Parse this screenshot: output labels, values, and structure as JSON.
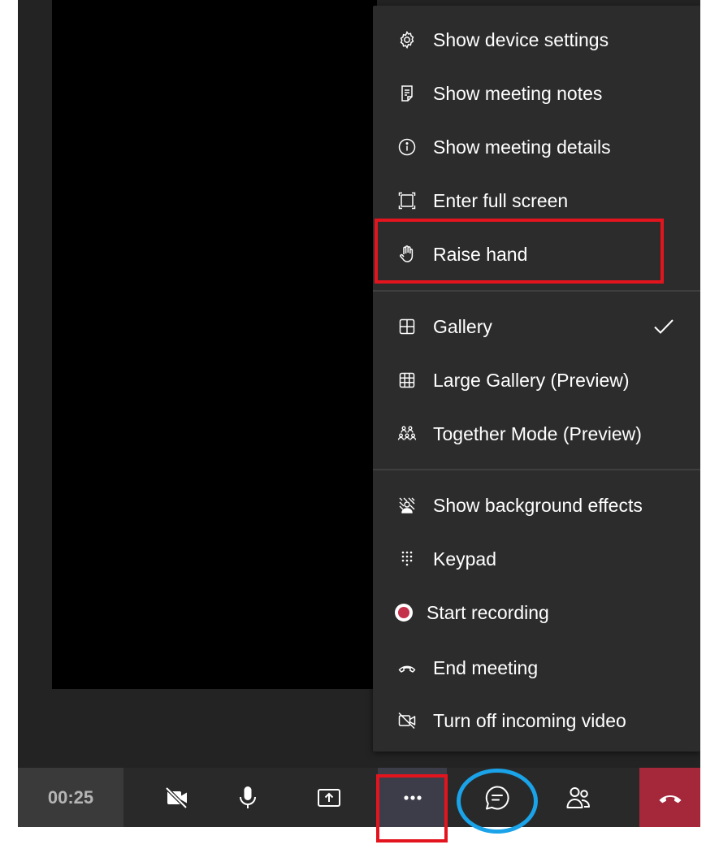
{
  "menu": {
    "items": [
      {
        "label": "Show device settings",
        "icon": "gear-icon"
      },
      {
        "label": "Show meeting notes",
        "icon": "notes-icon"
      },
      {
        "label": "Show meeting details",
        "icon": "info-icon"
      },
      {
        "label": "Enter full screen",
        "icon": "fullscreen-icon"
      },
      {
        "label": "Raise hand",
        "icon": "hand-icon"
      },
      {
        "label": "Gallery",
        "icon": "gallery-icon",
        "checked": true
      },
      {
        "label": "Large Gallery (Preview)",
        "icon": "large-gallery-icon"
      },
      {
        "label": "Together Mode (Preview)",
        "icon": "together-mode-icon"
      },
      {
        "label": "Show background effects",
        "icon": "background-effects-icon"
      },
      {
        "label": "Keypad",
        "icon": "keypad-icon"
      },
      {
        "label": "Start recording",
        "icon": "record-icon"
      },
      {
        "label": "End meeting",
        "icon": "end-meeting-icon"
      },
      {
        "label": "Turn off incoming video",
        "icon": "video-off-icon"
      }
    ]
  },
  "toolbar": {
    "timer": "00:25",
    "buttons": [
      "camera-off-icon",
      "microphone-icon",
      "share-screen-icon",
      "more-options-icon",
      "chat-icon",
      "participants-icon",
      "hang-up-icon"
    ]
  },
  "colors": {
    "background": "#232323",
    "menu": "#2c2c2c",
    "annotation_red": "#e3141e",
    "annotation_blue": "#1aa3e8",
    "hangup": "#a4283a",
    "record": "#c4314b"
  }
}
